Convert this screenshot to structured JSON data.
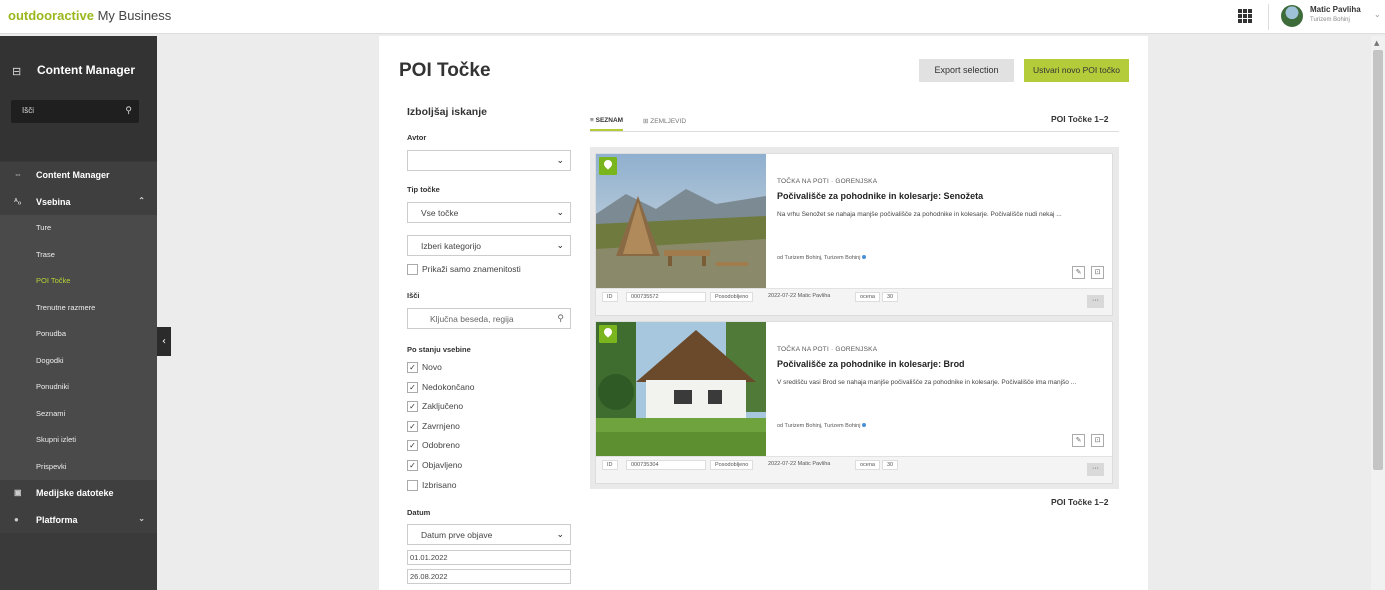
{
  "topbar": {
    "brand_primary": "outdooractive",
    "brand_secondary": "My Business",
    "user_name": "Matic Pavliha",
    "user_org": "Turizem Bohinj"
  },
  "sidebar": {
    "title": "Content Manager",
    "search_label": "Išči",
    "items": [
      {
        "label": "Content Manager",
        "level": "top"
      },
      {
        "label": "Vsebina",
        "level": "top"
      },
      {
        "label": "Ture",
        "level": "sub"
      },
      {
        "label": "Trase",
        "level": "sub"
      },
      {
        "label": "POI Točke",
        "level": "sub",
        "active": true
      },
      {
        "label": "Trenutne razmere",
        "level": "sub"
      },
      {
        "label": "Ponudba",
        "level": "sub"
      },
      {
        "label": "Dogodki",
        "level": "sub"
      },
      {
        "label": "Ponudniki",
        "level": "sub"
      },
      {
        "label": "Seznami",
        "level": "sub"
      },
      {
        "label": "Skupni izleti",
        "level": "sub"
      },
      {
        "label": "Prispevki",
        "level": "sub"
      },
      {
        "label": "Medijske datoteke",
        "level": "top"
      },
      {
        "label": "Platforma",
        "level": "top"
      }
    ]
  },
  "main": {
    "title": "POI Točke",
    "export_label": "Export selection",
    "new_label": "Ustvari novo POI točko"
  },
  "filters": {
    "heading": "Izboljšaj iskanje",
    "author_label": "Avtor",
    "author_value": "",
    "type_label": "Tip točke",
    "type_value": "Vse točke",
    "category_value": "Izberi kategorijo",
    "landmarks_label": "Prikaži samo znamenitosti",
    "search_label": "Išči",
    "search_placeholder": "Ključna beseda, regija",
    "status_label": "Po stanju vsebine",
    "statuses": [
      {
        "label": "Novo",
        "checked": true
      },
      {
        "label": "Nedokončano",
        "checked": true
      },
      {
        "label": "Zaključeno",
        "checked": true
      },
      {
        "label": "Zavrnjeno",
        "checked": true
      },
      {
        "label": "Odobreno",
        "checked": true
      },
      {
        "label": "Objavljeno",
        "checked": true
      },
      {
        "label": "Izbrisano",
        "checked": false
      }
    ],
    "date_label": "Datum",
    "date_type": "Datum prve objave",
    "date_from": "01.01.2022",
    "date_to": "26.08.2022"
  },
  "tabs": {
    "list": "SEZNAM",
    "map": "ZEMLJEVID"
  },
  "count_label": "POI Točke 1–2",
  "results": [
    {
      "category": "TOČKA NA POTI · GORENJSKA",
      "title": "Počivališče za pohodnike in kolesarje: Senožeta",
      "description": "Na vrhu Senožet se nahaja manjše počivališče za pohodnike in kolesarje. Počivališče nudi nekaj ...",
      "by": "od Turizem Bohinj, Turizem Bohinj",
      "id_label": "ID",
      "id": "000735572",
      "updated_label": "Posodobljeno",
      "updated": "2022-07-22 Matic Pavliha",
      "rating_label": "ocena",
      "rating": "30"
    },
    {
      "category": "TOČKA NA POTI · GORENJSKA",
      "title": "Počivališče za pohodnike in kolesarje: Brod",
      "description": "V središču vasi Brod se nahaja manjše počivališče za pohodnike in kolesarje. Počivališče ima manjšo ...",
      "by": "od Turizem Bohinj, Turizem Bohinj",
      "id_label": "ID",
      "id": "000735304",
      "updated_label": "Posodobljeno",
      "updated": "2022-07-22 Matic Pavliha",
      "rating_label": "ocena",
      "rating": "30"
    }
  ],
  "colors": {
    "accent": "#b5cc3a",
    "sidebar": "#3a3a3a",
    "active_nav": "#b4d334",
    "pin": "#7ab51d"
  }
}
